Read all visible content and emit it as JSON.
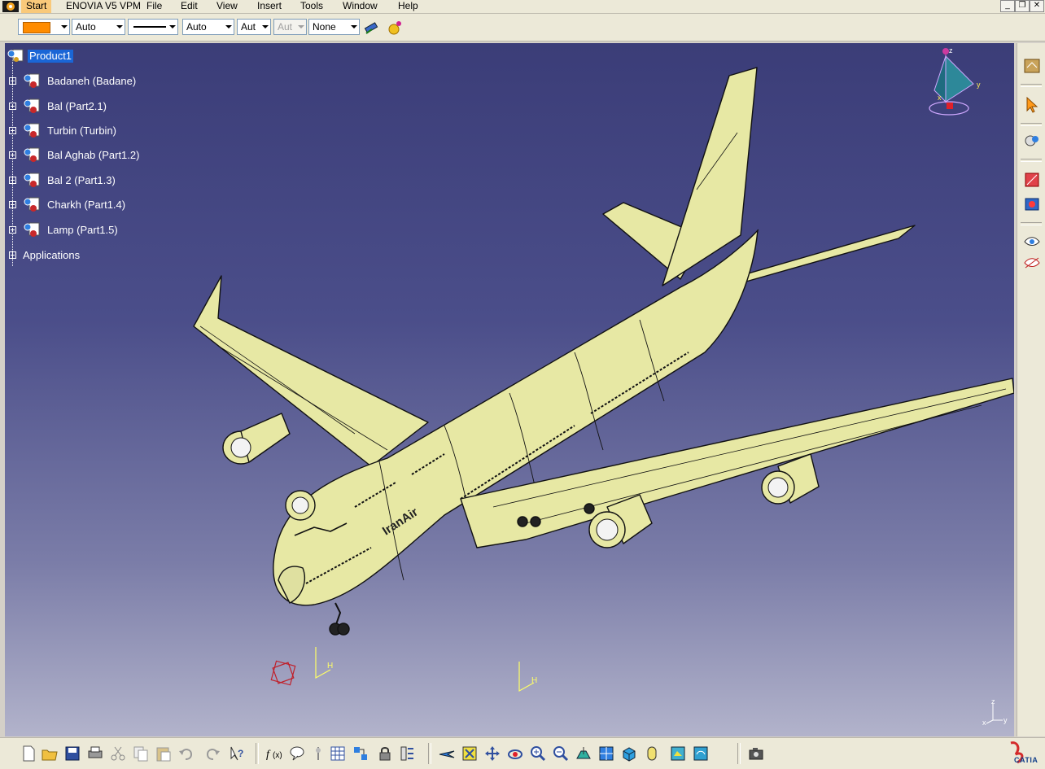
{
  "menu": {
    "items": [
      {
        "label": "Start"
      },
      {
        "label": "ENOVIA V5 VPM"
      },
      {
        "label": "File"
      },
      {
        "label": "Edit"
      },
      {
        "label": "View"
      },
      {
        "label": "Insert"
      },
      {
        "label": "Tools"
      },
      {
        "label": "Window"
      },
      {
        "label": "Help"
      }
    ],
    "window_buttons": {
      "minimize": "_",
      "restore": "❐",
      "close": "✕"
    }
  },
  "properties": {
    "fill_color": "#ff8c00",
    "transparency": "Auto",
    "line_thickness_option": "Auto",
    "line_type_option": "Aut",
    "point_type_option": "Aut",
    "layer": "None"
  },
  "tree": {
    "root": "Product1",
    "children": [
      {
        "label": "Badaneh (Badane)"
      },
      {
        "label": "Bal (Part2.1)"
      },
      {
        "label": "Turbin (Turbin)"
      },
      {
        "label": "Bal Aghab (Part1.2)"
      },
      {
        "label": "Bal 2 (Part1.3)"
      },
      {
        "label": "Charkh (Part1.4)"
      },
      {
        "label": "Lamp (Part1.5)"
      }
    ],
    "applications": "Applications"
  },
  "model": {
    "livery": "IranAir",
    "body_color": "#e7e8a4"
  },
  "compass": {
    "x": "x",
    "y": "y",
    "z": "z"
  },
  "axis_labels": {
    "h": "H",
    "x": "x",
    "y": "y",
    "z": "z"
  },
  "brand": {
    "name": "CATIA",
    "mark": "3DS"
  }
}
